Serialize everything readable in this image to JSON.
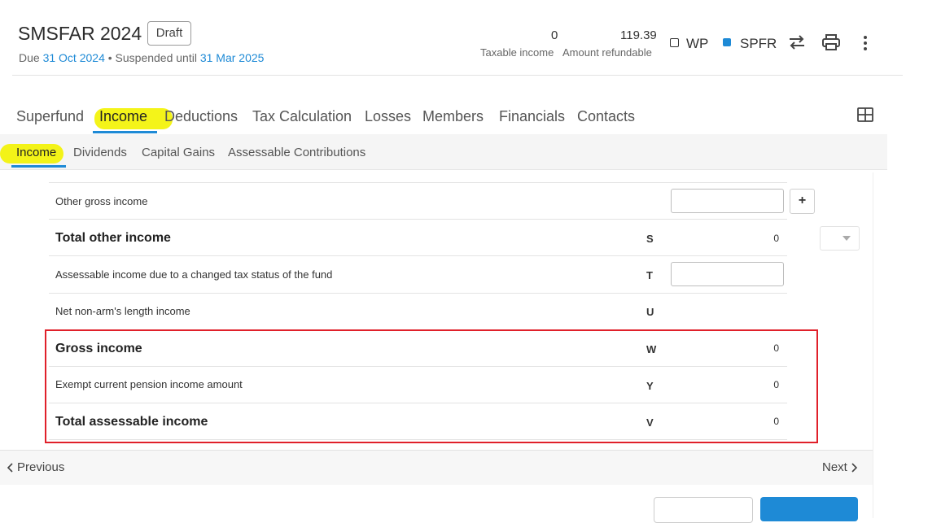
{
  "header": {
    "title": "SMSFAR 2024",
    "badge": "Draft",
    "due_prefix": "Due ",
    "due_date": "31 Oct 2024",
    "suspended_prefix": " • Suspended until ",
    "suspended_date": "31 Mar 2025",
    "taxable_income_value": "0",
    "taxable_income_label": "Taxable income",
    "amount_refundable_value": "119.39",
    "amount_refundable_label": "Amount refundable",
    "wp_label": "WP",
    "spfr_label": "SPFR"
  },
  "tabs": [
    "Superfund",
    "Income",
    "Deductions",
    "Tax Calculation",
    "Losses",
    "Members",
    "Financials",
    "Contacts"
  ],
  "subtabs": [
    "Income",
    "Dividends",
    "Capital Gains",
    "Assessable Contributions"
  ],
  "rows": [
    {
      "label": "Other gross income",
      "code": "",
      "value": ""
    },
    {
      "label": "Total other income",
      "code": "S",
      "value": "0"
    },
    {
      "label": "Assessable income due to a changed tax status of the fund",
      "code": "T",
      "value": ""
    },
    {
      "label": "Net non-arm's length income",
      "code": "U",
      "value": ""
    },
    {
      "label": "Gross income",
      "code": "W",
      "value": "0"
    },
    {
      "label": "Exempt current pension income amount",
      "code": "Y",
      "value": "0"
    },
    {
      "label": "Total assessable income",
      "code": "V",
      "value": "0"
    }
  ],
  "footer": {
    "previous": "Previous",
    "next": "Next"
  },
  "colors": {
    "accent": "#1e8ad6",
    "highlight": "#f3f300",
    "alert_border": "#e0202a"
  }
}
